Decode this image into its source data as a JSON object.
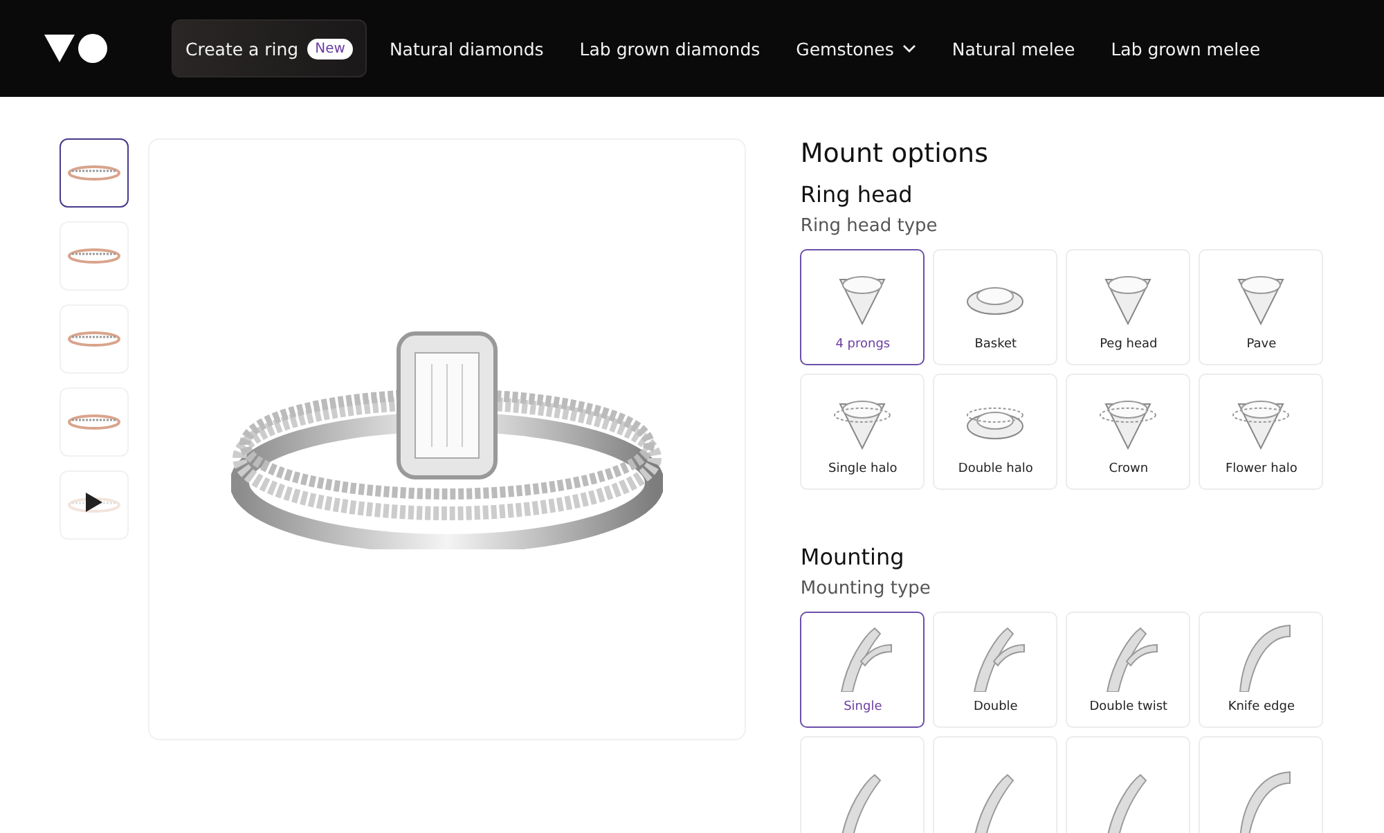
{
  "nav": {
    "items": [
      {
        "label": "Create a ring",
        "badge": "New",
        "selected": true,
        "dropdown": false
      },
      {
        "label": "Natural diamonds",
        "selected": false,
        "dropdown": false
      },
      {
        "label": "Lab grown diamonds",
        "selected": false,
        "dropdown": false
      },
      {
        "label": "Gemstones",
        "selected": false,
        "dropdown": true
      },
      {
        "label": "Natural melee",
        "selected": false,
        "dropdown": false
      },
      {
        "label": "Lab grown melee",
        "selected": false,
        "dropdown": false
      }
    ]
  },
  "gallery": {
    "thumbnails": [
      {
        "kind": "image",
        "selected": true
      },
      {
        "kind": "image",
        "selected": false
      },
      {
        "kind": "image",
        "selected": false
      },
      {
        "kind": "image",
        "selected": false
      },
      {
        "kind": "video",
        "selected": false
      }
    ]
  },
  "mount_options": {
    "title": "Mount options",
    "sections": [
      {
        "title": "Ring head",
        "subtitle": "Ring head type",
        "kind": "head",
        "options": [
          {
            "label": "4 prongs",
            "selected": true
          },
          {
            "label": "Basket",
            "selected": false
          },
          {
            "label": "Peg head",
            "selected": false
          },
          {
            "label": "Pave",
            "selected": false
          },
          {
            "label": "Single halo",
            "selected": false
          },
          {
            "label": "Double halo",
            "selected": false
          },
          {
            "label": "Crown",
            "selected": false
          },
          {
            "label": "Flower halo",
            "selected": false
          }
        ]
      },
      {
        "title": "Mounting",
        "subtitle": "Mounting type",
        "kind": "band",
        "options": [
          {
            "label": "Single",
            "selected": true
          },
          {
            "label": "Double",
            "selected": false
          },
          {
            "label": "Double twist",
            "selected": false
          },
          {
            "label": "Knife edge",
            "selected": false
          },
          {
            "selected": false
          },
          {
            "selected": false
          },
          {
            "selected": false
          },
          {
            "selected": false
          }
        ]
      }
    ]
  }
}
